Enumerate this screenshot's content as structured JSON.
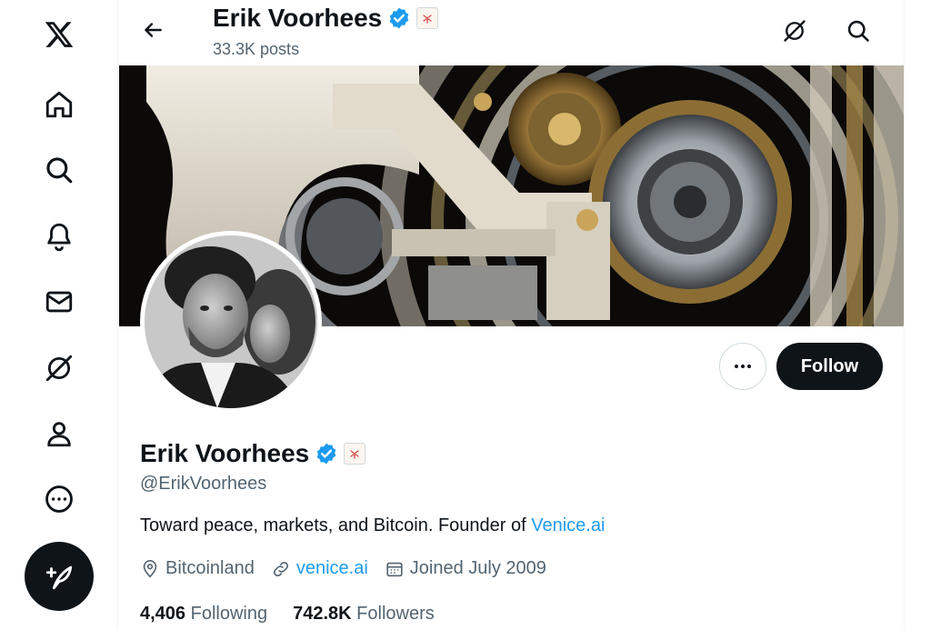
{
  "app": {
    "name": "X"
  },
  "colors": {
    "accent": "#1d9bf0",
    "text": "#0f1419",
    "muted": "#536471",
    "follow_bg": "#0f1419"
  },
  "nav": {
    "items": [
      {
        "icon": "x-logo-icon"
      },
      {
        "icon": "home-icon"
      },
      {
        "icon": "explore-icon"
      },
      {
        "icon": "notifications-icon"
      },
      {
        "icon": "messages-icon"
      },
      {
        "icon": "grok-icon"
      },
      {
        "icon": "profile-icon"
      },
      {
        "icon": "more-icon"
      }
    ],
    "post_button_icon": "compose-post-icon"
  },
  "header": {
    "name": "Erik Voorhees",
    "posts": "33.3K posts",
    "icons": [
      "back-arrow-icon",
      "grok-icon",
      "search-icon"
    ]
  },
  "profile": {
    "display_name": "Erik Voorhees",
    "handle": "@ErikVoorhees",
    "bio_text": "Toward peace, markets, and Bitcoin. Founder of ",
    "bio_link": "Venice.ai",
    "location": "Bitcoinland",
    "website": "venice.ai",
    "joined": "Joined July 2009",
    "following_count": "4,406",
    "following_label": "Following",
    "followers_count": "742.8K",
    "followers_label": "Followers"
  },
  "actions": {
    "follow_label": "Follow",
    "more_icon": "more-dots-icon"
  }
}
